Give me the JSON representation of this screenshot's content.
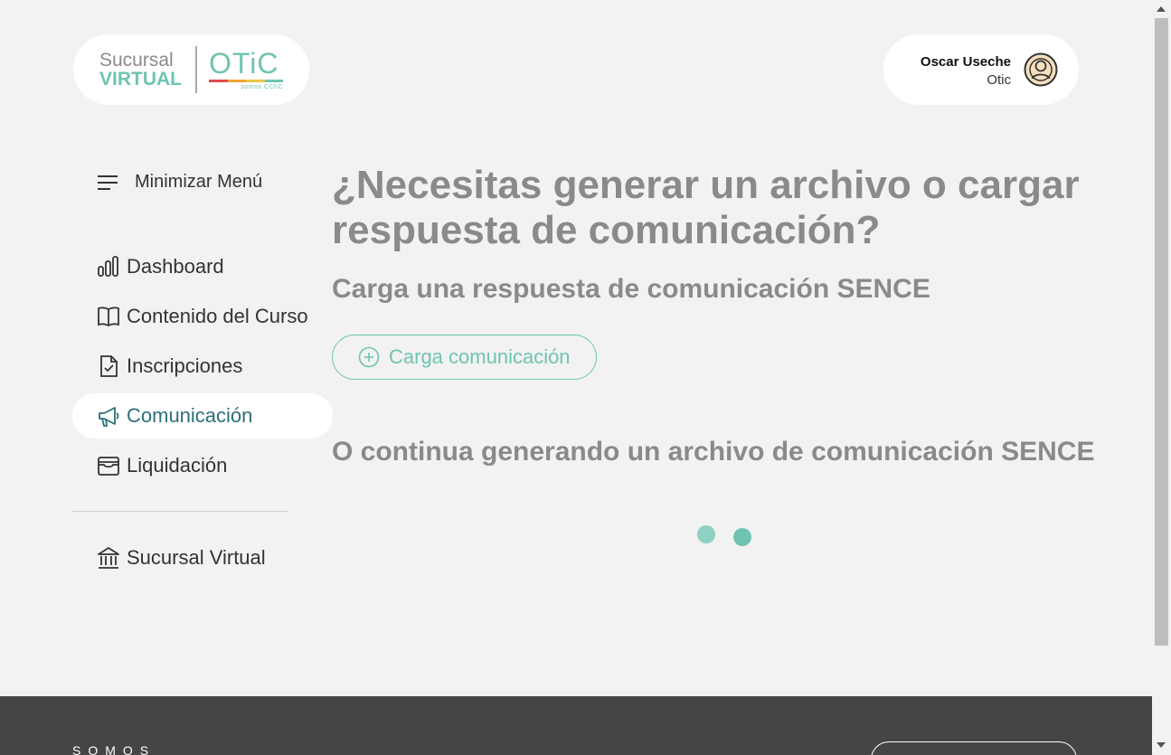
{
  "logo": {
    "sucursal": "Sucursal",
    "virtual": "VIRTUAL",
    "otic": "OTiC",
    "somos": "somos CChC",
    "colors": {
      "teal": "#6ec4b1",
      "gray": "#8a8a8a",
      "bar": [
        "#e04b4b",
        "#f0a33a",
        "#e8c64a",
        "#6ec4b1"
      ]
    }
  },
  "user": {
    "name": "Oscar Useche",
    "role": "Otic",
    "avatar_icon": "user-circle-icon"
  },
  "sidebar": {
    "toggle": {
      "label": "Minimizar Menú",
      "icon": "hamburger-icon"
    },
    "items": [
      {
        "label": "Dashboard",
        "icon": "bar-chart-icon",
        "active": false
      },
      {
        "label": "Contenido del Curso",
        "icon": "book-icon",
        "active": false
      },
      {
        "label": "Inscripciones",
        "icon": "document-check-icon",
        "active": false
      },
      {
        "label": "Comunicación",
        "icon": "megaphone-icon",
        "active": true
      },
      {
        "label": "Liquidación",
        "icon": "wallet-icon",
        "active": false
      }
    ],
    "secondary": [
      {
        "label": "Sucursal Virtual",
        "icon": "bank-icon"
      }
    ]
  },
  "main": {
    "title": "¿Necesitas generar un archivo o cargar respuesta de comunicación?",
    "upload_heading": "Carga una respuesta de comunicación SENCE",
    "upload_button": "Carga comunicación",
    "generate_heading": "O continua generando un archivo de comunicación SENCE",
    "loader_colors": [
      "#8fd0c2",
      "#6ec4b1"
    ]
  },
  "footer": {
    "somos": "SOMOS"
  }
}
